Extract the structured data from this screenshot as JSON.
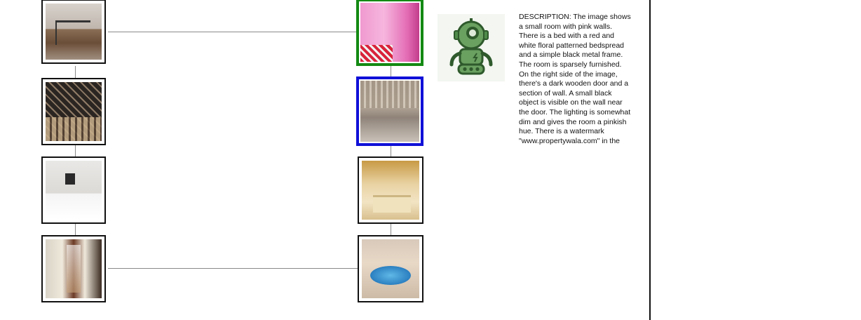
{
  "description": {
    "text": "DESCRIPTION: The image shows a small room with pink walls. There is a bed with a red and white floral patterned bedspread and a simple black metal frame. The room is sparsely furnished. On the right side of the image, there's a dark wooden door and a section of wall. A small black object is visible on the wall near the door. The lighting is somewhat dim and gives the room a pinkish hue. There is a watermark \"www.propertywala.com\" in the"
  },
  "avatar": {
    "icon": "robot-icon"
  },
  "colors": {
    "selected_green": "#138a13",
    "selected_blue": "#1010d8",
    "robot_green": "#4f8a4a"
  },
  "left_column": [
    {
      "scene": "home office"
    },
    {
      "scene": "wine cellar"
    },
    {
      "scene": "hotel room"
    },
    {
      "scene": "hallway"
    }
  ],
  "right_column": [
    {
      "scene": "pink room",
      "selected": "green"
    },
    {
      "scene": "basement",
      "selected": "blue"
    },
    {
      "scene": "bedroom"
    },
    {
      "scene": "indoor pool"
    }
  ]
}
